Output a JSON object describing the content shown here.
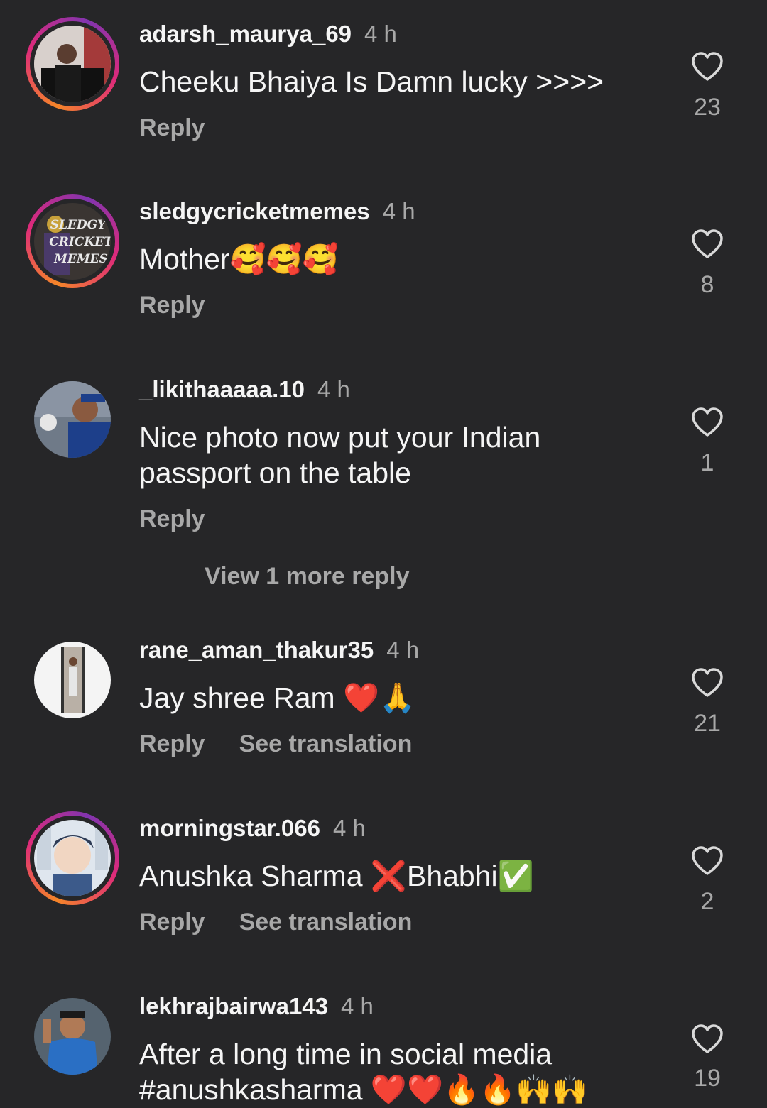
{
  "comments": [
    {
      "username": "adarsh_maurya_69",
      "time": "4 h",
      "text": "Cheeku Bhaiya Is Damn lucky >>>>",
      "reply": "Reply",
      "likes": "23"
    },
    {
      "username": "sledgycricketmemes",
      "time": "4 h",
      "text": "Mother",
      "emoji": "🥰🥰🥰",
      "reply": "Reply",
      "likes": "8",
      "avatar_text": [
        "SLEDGY",
        "CRICKET",
        "MEMES"
      ]
    },
    {
      "username": "_likithaaaaa.10",
      "time": "4 h",
      "text": "Nice photo now put your Indian passport on the table",
      "reply": "Reply",
      "likes": "1"
    },
    {
      "username": "rane_aman_thakur35",
      "time": "4 h",
      "text": "Jay shree Ram ",
      "emoji": "❤️🙏",
      "reply": "Reply",
      "translate": "See translation",
      "likes": "21"
    },
    {
      "username": "morningstar.066",
      "time": "4 h",
      "text": "Anushka Sharma ",
      "emoji1": "❌",
      "text2": "Bhabhi",
      "emoji2": "✅",
      "reply": "Reply",
      "translate": "See translation",
      "likes": "2"
    },
    {
      "username": "lekhrajbairwa143",
      "time": "4 h",
      "text": "After a long time in social media #anushkasharma ",
      "emoji": "❤️❤️🔥🔥🙌🙌",
      "likes": "19"
    }
  ],
  "view_more_replies": "View 1 more reply",
  "icons": {
    "like": "heart-outline-icon"
  },
  "colors": {
    "background": "#262628",
    "secondary_text": "#a8a8a8",
    "primary_text": "#f5f5f5"
  }
}
